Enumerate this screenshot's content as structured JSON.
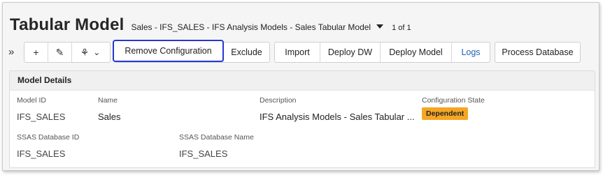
{
  "header": {
    "title": "Tabular Model",
    "context": "Sales - IFS_SALES - IFS Analysis Models - Sales Tabular Model",
    "counter": "1 of 1"
  },
  "toolbar": {
    "chevron_glyph": "»",
    "add_glyph": "+",
    "edit_glyph": "✎",
    "menu_glyph": "⚘",
    "menu_caret": "⌄",
    "remove_configuration": "Remove Configuration",
    "exclude": "Exclude",
    "import": "Import",
    "deploy_dw": "Deploy DW",
    "deploy_model": "Deploy Model",
    "logs": "Logs",
    "process_database": "Process Database"
  },
  "details": {
    "header": "Model Details",
    "model_id_label": "Model ID",
    "model_id_value": "IFS_SALES",
    "name_label": "Name",
    "name_value": "Sales",
    "description_label": "Description",
    "description_value": "IFS Analysis Models - Sales Tabular ...",
    "config_state_label": "Configuration State",
    "config_state_value": "Dependent",
    "ssas_db_id_label": "SSAS Database ID",
    "ssas_db_id_value": "IFS_SALES",
    "ssas_db_name_label": "SSAS Database Name",
    "ssas_db_name_value": "IFS_SALES"
  },
  "colors": {
    "badge": "#f5a623",
    "highlight_border": "#2438d6",
    "link": "#1f5fb5"
  }
}
